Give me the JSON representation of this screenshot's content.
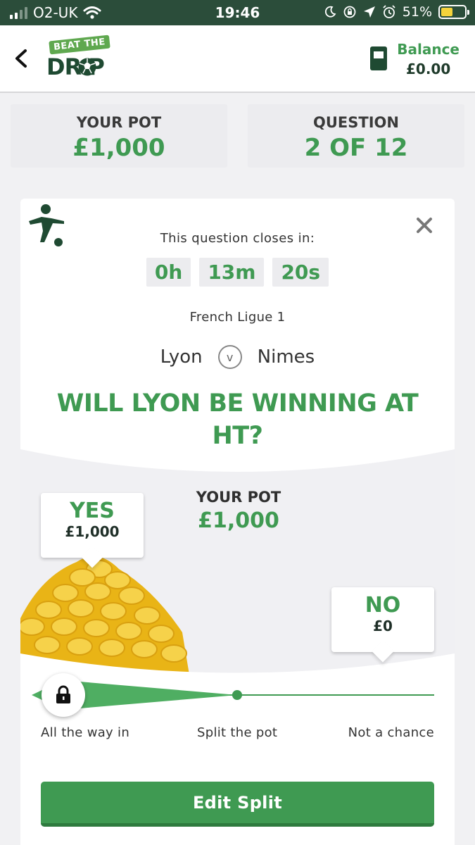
{
  "status_bar": {
    "carrier": "O2-UK",
    "time": "19:46",
    "battery": "51%",
    "battery_level": 0.51,
    "icons": [
      "signal-icon",
      "wifi-icon",
      "moon-icon",
      "rotation-lock-icon",
      "location-icon",
      "alarm-icon",
      "battery-icon"
    ]
  },
  "header": {
    "logo_top": "BEAT THE",
    "logo_bottom": "DR P",
    "balance_label": "Balance",
    "balance_value": "£0.00"
  },
  "pot_card": {
    "title": "YOUR POT",
    "value": "£1,000"
  },
  "question_card": {
    "title": "QUESTION",
    "value": "2 OF 12"
  },
  "question": {
    "closes_label": "This question closes in:",
    "timer": {
      "hours": "0h",
      "minutes": "13m",
      "seconds": "20s"
    },
    "league": "French Ligue 1",
    "home_team": "Lyon",
    "vs": "v",
    "away_team": "Nimes",
    "text": "WILL LYON BE WINNING AT HT?"
  },
  "split": {
    "pot_label": "YOUR POT",
    "pot_value": "£1,000",
    "yes_label": "YES",
    "yes_amount": "£1,000",
    "no_label": "NO",
    "no_amount": "£0",
    "slider_position": 0.0,
    "labels": {
      "left": "All the way in",
      "middle": "Split the pot",
      "right": "Not a chance"
    }
  },
  "edit_button": "Edit Split",
  "colors": {
    "brand_green": "#3f9a52",
    "dark_green": "#1f4a32",
    "status_bar": "#2b4d3a",
    "coin_gold": "#f2c21d"
  }
}
